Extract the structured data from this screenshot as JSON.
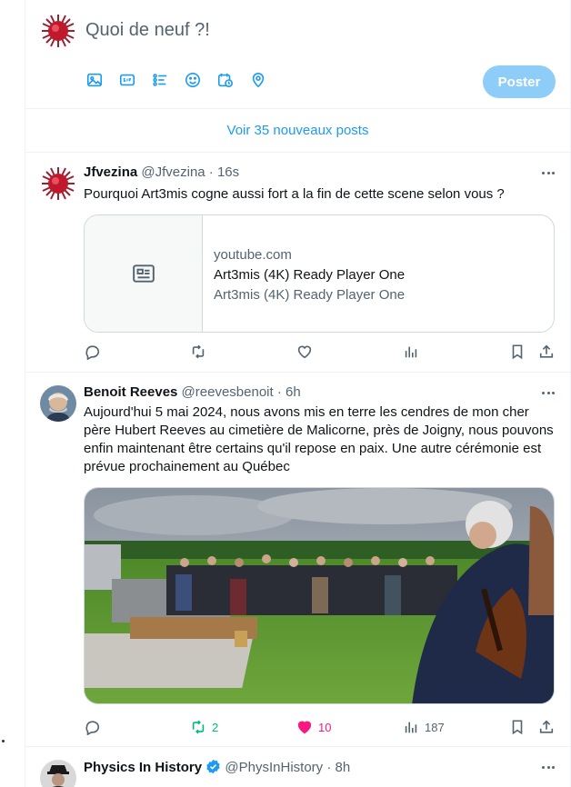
{
  "compose": {
    "placeholder": "Quoi de neuf ?!",
    "tools": [
      "image-icon",
      "gif-icon",
      "poll-icon",
      "emoji-icon",
      "schedule-icon",
      "location-icon"
    ],
    "post_label": "Poster"
  },
  "new_posts": {
    "label": "Voir 35 nouveaux posts"
  },
  "tweets": [
    {
      "name": "Jfvezina",
      "meta": "@Jfvezina · 16s",
      "text": "Pourquoi Art3mis cogne aussi fort a la fin de cette scene selon vous ?",
      "card": {
        "domain": "youtube.com",
        "title": "Art3mis (4K) Ready Player One",
        "description": "Art3mis (4K) Ready Player One"
      }
    },
    {
      "name": "Benoit Reeves",
      "meta": "@reevesbenoit · 6h",
      "text": "Aujourd'hui 5 mai 2024, nous avons mis en terre les cendres de mon cher père Hubert Reeves au cimetière de Malicorne, près de Joigny, nous pouvons enfin maintenant être certains qu'il repose en paix. Une autre cérémonie est prévue prochainement au Québec",
      "stats": {
        "reposts": "2",
        "likes": "10",
        "views": "187"
      }
    },
    {
      "name": "Physics In History",
      "meta": "@PhysInHistory · 8h"
    }
  ],
  "colors": {
    "accent": "#1d9bf0",
    "accent_disabled": "#8ecdf8",
    "repost": "#00ba7c",
    "like": "#f91880",
    "secondary_text": "#536471"
  }
}
